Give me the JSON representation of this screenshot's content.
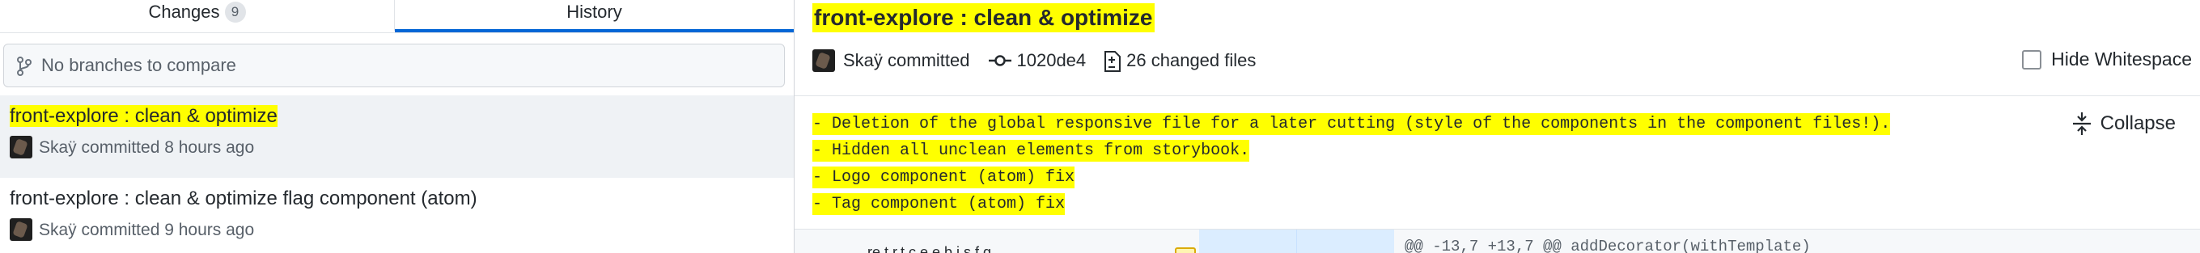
{
  "tabs": {
    "changes_label": "Changes",
    "changes_count": "9",
    "history_label": "History"
  },
  "compare": {
    "placeholder": "No branches to compare"
  },
  "history": {
    "commits": [
      {
        "title": "front-explore : clean & optimize",
        "meta": "Skaÿ committed 8 hours ago"
      },
      {
        "title": "front-explore : clean & optimize flag component (atom)",
        "meta": "Skaÿ committed 9 hours ago"
      }
    ]
  },
  "details": {
    "title": "front-explore : clean & optimize",
    "author": "Skaÿ committed",
    "sha": "1020de4",
    "changed_files": "26 changed files",
    "hide_whitespace_label": "Hide Whitespace",
    "collapse_label": "Collapse",
    "message_lines": [
      "- Deletion of the global responsive file for a later cutting (style of the components in the component files!).",
      "- Hidden all unclean elements from storybook.",
      "- Logo component (atom) fix",
      "- Tag component (atom) fix"
    ],
    "hunk_header": "@@ -13,7 +13,7 @@ addDecorator(withTemplate)",
    "file_peek": "re.t.r.t.c.e.e.b.j.s.f.g."
  },
  "colors": {
    "highlight": "#ffff00",
    "selected_row": "#eff2f5",
    "tab_underline": "#0366d6"
  },
  "icons": [
    "branch-icon",
    "git-commit-icon",
    "file-diff-icon",
    "checkbox",
    "collapse-icon",
    "avatar"
  ]
}
